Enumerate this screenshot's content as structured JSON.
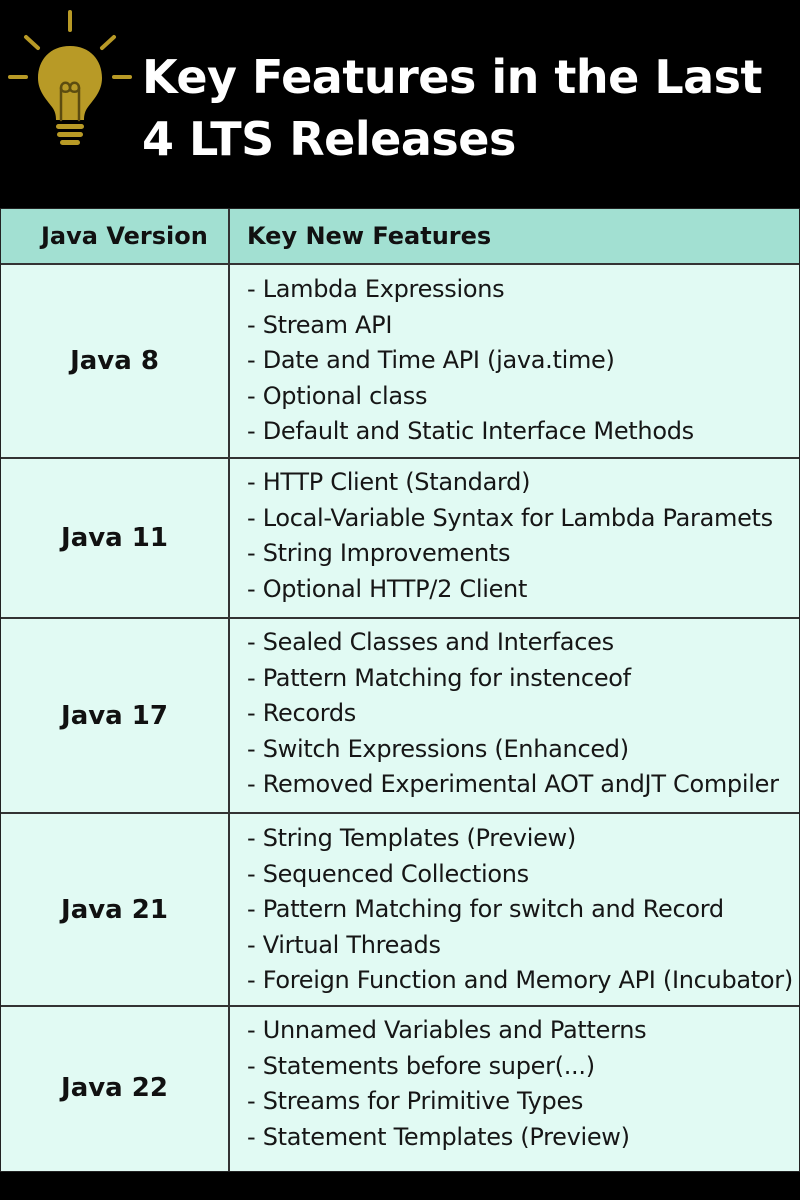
{
  "header": {
    "title_line1": "Key Features in the Last",
    "title_line2": "4 LTS Releases",
    "icon": "lightbulb-icon",
    "icon_color": "#b89a26"
  },
  "table": {
    "columns": [
      "Java Version",
      "Key New Features"
    ],
    "rows": [
      {
        "version": "Java 8",
        "features": [
          "- Lambda Expressions",
          "- Stream API",
          "- Date and Time API (java.time)",
          "- Optional class",
          "- Default and Static Interface Methods"
        ]
      },
      {
        "version": "Java 11",
        "features": [
          "- HTTP Client (Standard)",
          "- Local-Variable Syntax for Lambda Paramets",
          "- String Improvements",
          "- Optional HTTP/2 Client"
        ]
      },
      {
        "version": "Java 17",
        "features": [
          "- Sealed Classes and Interfaces",
          "- Pattern Matching for instenceof",
          "- Records",
          "- Switch Expressions (Enhanced)",
          "- Removed Experimental AOT andJT Compiler"
        ]
      },
      {
        "version": "Java 21",
        "features": [
          "- String Templates (Preview)",
          "- Sequenced Collections",
          "- Pattern Matching for switch and Record",
          "- Virtual Threads",
          "- Foreign Function and Memory API (Incubator)"
        ]
      },
      {
        "version": "Java 22",
        "features": [
          "- Unnamed Variables and Patterns",
          "- Statements before super(...)",
          "- Streams for Primitive Types",
          "- Statement Templates (Preview)"
        ]
      }
    ]
  },
  "colors": {
    "background": "#000000",
    "header_row": "#a2e0d2",
    "body_rows": "#e1faf3",
    "title_text": "#ffffff"
  }
}
